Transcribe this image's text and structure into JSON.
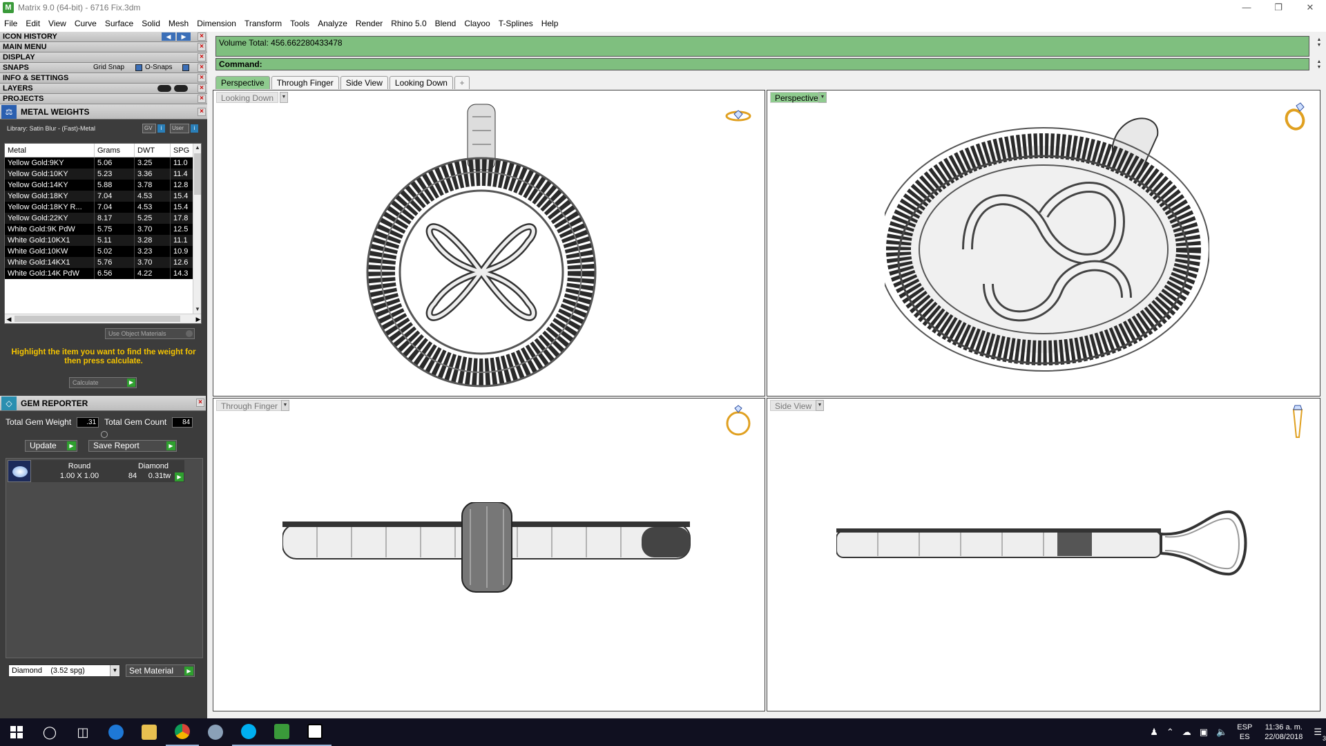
{
  "window": {
    "title": "Matrix 9.0 (64-bit) - 6716 Fix.3dm",
    "app_icon": "M"
  },
  "menu": [
    "File",
    "Edit",
    "View",
    "Curve",
    "Surface",
    "Solid",
    "Mesh",
    "Dimension",
    "Transform",
    "Tools",
    "Analyze",
    "Render",
    "Rhino 5.0",
    "Blend",
    "Clayoo",
    "T-Splines",
    "Help"
  ],
  "sections": {
    "icon_history": "ICON HISTORY",
    "main_menu": "MAIN MENU",
    "display": "DISPLAY",
    "snaps": "SNAPS",
    "grid_snap": "Grid Snap",
    "o_snaps": "O-Snaps",
    "info": "INFO & SETTINGS",
    "layers": "LAYERS",
    "projects": "PROJECTS"
  },
  "metal_weights": {
    "title": "METAL WEIGHTS",
    "library": "Library: Satin Blur - (Fast)-Metal",
    "gv": "GV",
    "user": "User",
    "columns": {
      "metal": "Metal",
      "grams": "Grams",
      "dwt": "DWT",
      "spg": "SPG"
    },
    "rows": [
      {
        "metal": "Yellow Gold:9KY",
        "grams": "5.06",
        "dwt": "3.25",
        "spg": "11.0"
      },
      {
        "metal": "Yellow Gold:10KY",
        "grams": "5.23",
        "dwt": "3.36",
        "spg": "11.4"
      },
      {
        "metal": "Yellow Gold:14KY",
        "grams": "5.88",
        "dwt": "3.78",
        "spg": "12.8"
      },
      {
        "metal": "Yellow Gold:18KY",
        "grams": "7.04",
        "dwt": "4.53",
        "spg": "15.4"
      },
      {
        "metal": "Yellow Gold:18KY R...",
        "grams": "7.04",
        "dwt": "4.53",
        "spg": "15.4"
      },
      {
        "metal": "Yellow Gold:22KY",
        "grams": "8.17",
        "dwt": "5.25",
        "spg": "17.8"
      },
      {
        "metal": "White Gold:9K PdW",
        "grams": "5.75",
        "dwt": "3.70",
        "spg": "12.5"
      },
      {
        "metal": "White Gold:10KX1",
        "grams": "5.11",
        "dwt": "3.28",
        "spg": "11.1"
      },
      {
        "metal": "White Gold:10KW",
        "grams": "5.02",
        "dwt": "3.23",
        "spg": "10.9"
      },
      {
        "metal": "White Gold:14KX1",
        "grams": "5.76",
        "dwt": "3.70",
        "spg": "12.6"
      },
      {
        "metal": "White Gold:14K PdW",
        "grams": "6.56",
        "dwt": "4.22",
        "spg": "14.3"
      }
    ],
    "use_object_materials": "Use Object Materials",
    "hint": "Highlight the item you want to find the weight for then press calculate.",
    "calculate": "Calculate"
  },
  "gem_reporter": {
    "title": "GEM REPORTER",
    "total_weight_label": "Total Gem Weight",
    "total_weight": ".31",
    "total_count_label": "Total Gem Count",
    "total_count": "84",
    "update": "Update",
    "save_report": "Save Report",
    "item": {
      "shape": "Round",
      "type": "Diamond",
      "size": "1.00 X 1.00",
      "count": "84",
      "weight": "0.31tw"
    },
    "material_select": "Diamond    (3.52 spg)",
    "set_material": "Set Material"
  },
  "command": {
    "volume": "Volume Total: 456.662280433478",
    "label": "Command:"
  },
  "tabs": [
    "Perspective",
    "Through Finger",
    "Side View",
    "Looking Down"
  ],
  "tab_add": "+",
  "viewports": {
    "top_left": "Looking Down",
    "top_right": "Perspective",
    "bottom_left": "Through Finger",
    "bottom_right": "Side View"
  },
  "taskbar": {
    "lang": "ESP",
    "lang2": "ES",
    "time": "11:36 a. m.",
    "date": "22/08/2018",
    "notif": "3"
  }
}
